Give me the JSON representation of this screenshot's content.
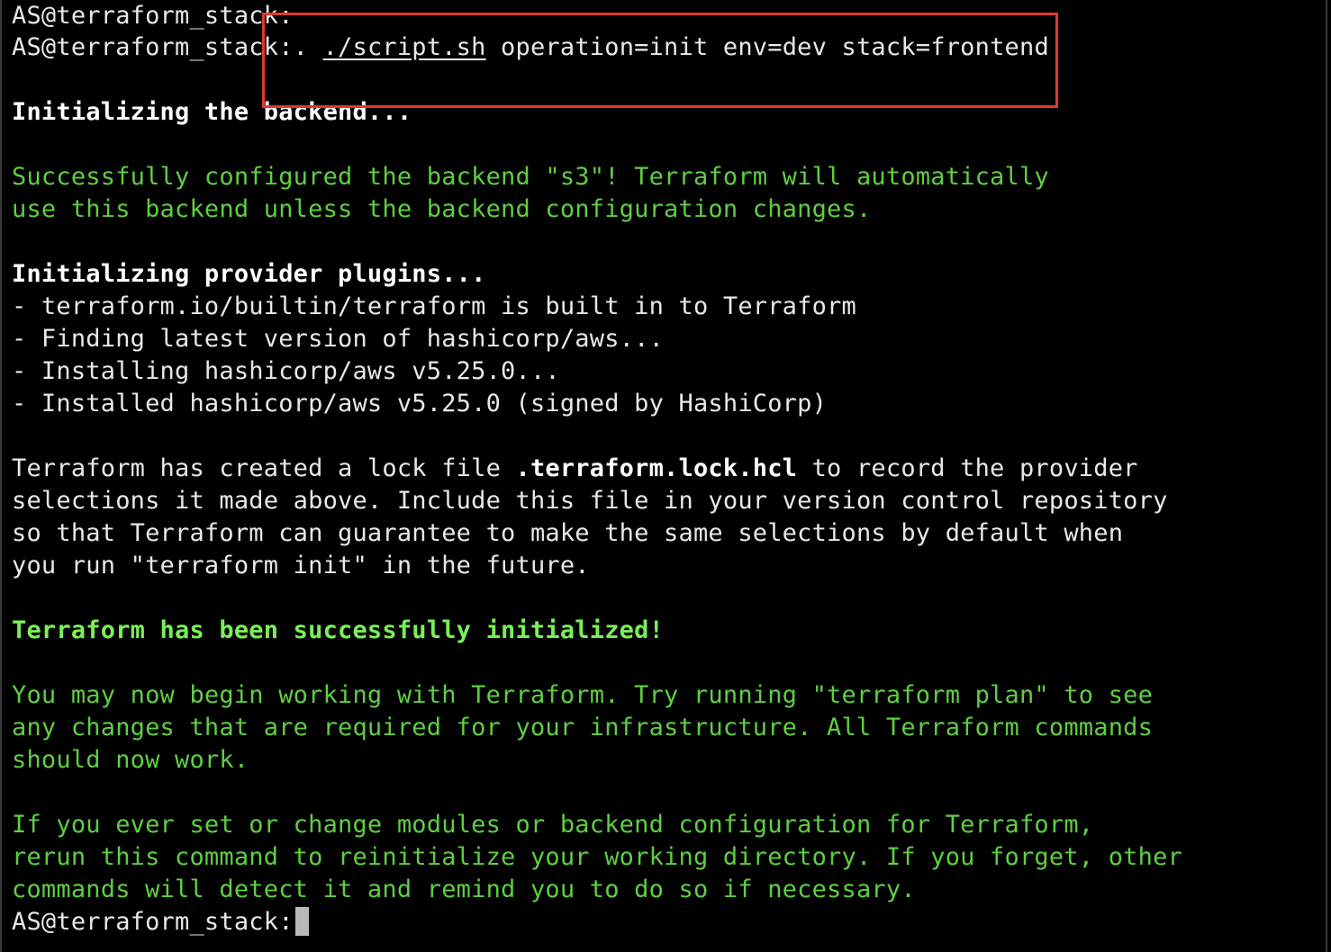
{
  "terminal": {
    "prompt_line_1": "AS@terraform_stack:",
    "prompt_line_2": "AS@terraform_stack:",
    "command_prefix": ". ",
    "command_script": "./script.sh",
    "command_args": " operation=init env=dev stack=frontend",
    "init_backend": "Initializing the backend...",
    "backend_success_1": "Successfully configured the backend \"s3\"! Terraform will automatically",
    "backend_success_2": "use this backend unless the backend configuration changes.",
    "init_plugins": "Initializing provider plugins...",
    "plugin_1": "- terraform.io/builtin/terraform is built in to Terraform",
    "plugin_2": "- Finding latest version of hashicorp/aws...",
    "plugin_3": "- Installing hashicorp/aws v5.25.0...",
    "plugin_4": "- Installed hashicorp/aws v5.25.0 (signed by HashiCorp)",
    "lock_1_pre": "Terraform has created a lock file ",
    "lock_1_file": ".terraform.lock.hcl",
    "lock_1_post": " to record the provider",
    "lock_2": "selections it made above. Include this file in your version control repository",
    "lock_3": "so that Terraform can guarantee to make the same selections by default when",
    "lock_4": "you run \"terraform init\" in the future.",
    "success_heading": "Terraform has been successfully initialized!",
    "next_1": "You may now begin working with Terraform. Try running \"terraform plan\" to see",
    "next_2": "any changes that are required for your infrastructure. All Terraform commands",
    "next_3": "should now work.",
    "rerun_1": "If you ever set or change modules or backend configuration for Terraform,",
    "rerun_2": "rerun this command to reinitialize your working directory. If you forget, other",
    "rerun_3": "commands will detect it and remind you to do so if necessary.",
    "prompt_final": "AS@terraform_stack:"
  },
  "colors": {
    "background": "#000000",
    "text": "#e6e6e6",
    "success_green": "#5fce42",
    "highlight_red": "#e0392b"
  }
}
